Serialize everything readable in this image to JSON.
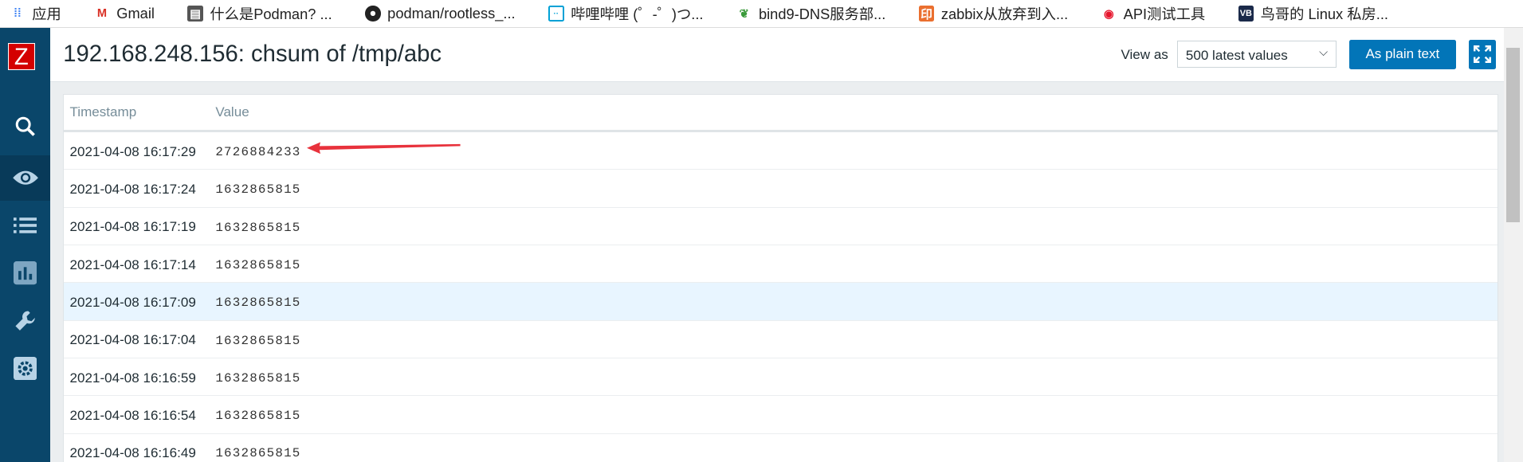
{
  "bookmarks": [
    {
      "label": "应用",
      "icon": "apps-grid-icon"
    },
    {
      "label": "Gmail",
      "icon": "gmail-icon"
    },
    {
      "label": "什么是Podman? ...",
      "icon": "doc-icon"
    },
    {
      "label": "podman/rootless_...",
      "icon": "github-icon"
    },
    {
      "label": "哔哩哔哩 (゜-゜)つ...",
      "icon": "bilibili-icon"
    },
    {
      "label": "bind9-DNS服务部...",
      "icon": "leaf-icon"
    },
    {
      "label": "zabbix从放弃到入...",
      "icon": "jianshu-icon"
    },
    {
      "label": "API测试工具",
      "icon": "weibo-icon"
    },
    {
      "label": "鸟哥的 Linux 私房...",
      "icon": "vbird-icon"
    }
  ],
  "sidebar": {
    "logo": "Z",
    "items": [
      {
        "icon": "search-icon"
      },
      {
        "icon": "eye-icon",
        "active": true
      },
      {
        "icon": "list-icon"
      },
      {
        "icon": "chart-icon"
      },
      {
        "icon": "wrench-icon"
      },
      {
        "icon": "gear-icon"
      }
    ]
  },
  "header": {
    "title": "192.168.248.156: chsum of /tmp/abc",
    "view_as_label": "View as",
    "view_as_value": "500 latest values",
    "plain_text_button": "As plain text"
  },
  "table": {
    "columns": [
      "Timestamp",
      "Value"
    ],
    "rows": [
      {
        "timestamp": "2021-04-08 16:17:29",
        "value": "2726884233"
      },
      {
        "timestamp": "2021-04-08 16:17:24",
        "value": "1632865815"
      },
      {
        "timestamp": "2021-04-08 16:17:19",
        "value": "1632865815"
      },
      {
        "timestamp": "2021-04-08 16:17:14",
        "value": "1632865815"
      },
      {
        "timestamp": "2021-04-08 16:17:09",
        "value": "1632865815"
      },
      {
        "timestamp": "2021-04-08 16:17:04",
        "value": "1632865815"
      },
      {
        "timestamp": "2021-04-08 16:16:59",
        "value": "1632865815"
      },
      {
        "timestamp": "2021-04-08 16:16:54",
        "value": "1632865815"
      },
      {
        "timestamp": "2021-04-08 16:16:49",
        "value": "1632865815"
      }
    ]
  },
  "colors": {
    "sidebar": "#0a466a",
    "accent": "#0275b8",
    "highlight_row": "#e8f5ff",
    "arrow": "#e8323c"
  }
}
